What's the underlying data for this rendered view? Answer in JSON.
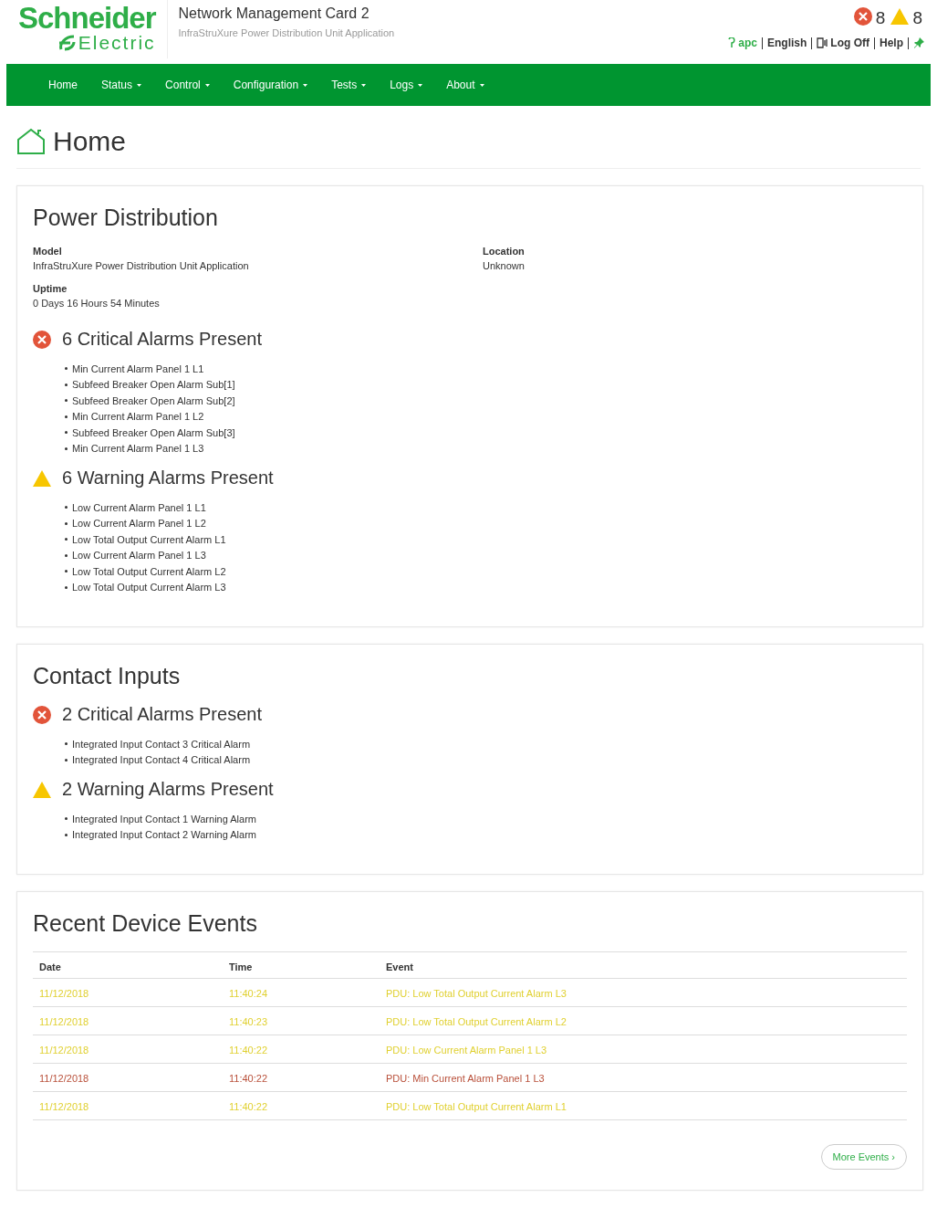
{
  "header": {
    "logo_top": "Schneider",
    "logo_bottom": "Electric",
    "title": "Network Management Card 2",
    "subtitle": "InfraStruXure Power Distribution Unit Application",
    "alarm_counts": [
      {
        "kind": "critical",
        "count": "8"
      },
      {
        "kind": "warning",
        "count": "8"
      }
    ],
    "user": "apc",
    "links": [
      "English",
      "Log Off",
      "Help"
    ]
  },
  "nav": [
    {
      "label": "Home",
      "dropdown": false
    },
    {
      "label": "Status",
      "dropdown": true
    },
    {
      "label": "Control",
      "dropdown": true
    },
    {
      "label": "Configuration",
      "dropdown": true
    },
    {
      "label": "Tests",
      "dropdown": true
    },
    {
      "label": "Logs",
      "dropdown": true
    },
    {
      "label": "About",
      "dropdown": true
    }
  ],
  "page_title": "Home",
  "power_distribution": {
    "title": "Power Distribution",
    "fields": [
      {
        "label": "Model",
        "value": "InfraStruXure Power Distribution Unit Application"
      },
      {
        "label": "Location",
        "value": "Unknown"
      },
      {
        "label": "Uptime",
        "value": "0 Days 16 Hours 54 Minutes"
      }
    ],
    "alarm_groups": [
      {
        "kind": "critical",
        "heading": "6 Critical Alarms Present",
        "items": [
          "Min Current Alarm Panel 1 L1",
          "Subfeed Breaker Open Alarm Sub[1]",
          "Subfeed Breaker Open Alarm Sub[2]",
          "Min Current Alarm Panel 1 L2",
          "Subfeed Breaker Open Alarm Sub[3]",
          "Min Current Alarm Panel 1 L3"
        ]
      },
      {
        "kind": "warning",
        "heading": "6 Warning Alarms Present",
        "items": [
          "Low Current Alarm Panel 1 L1",
          "Low Current Alarm Panel 1 L2",
          "Low Total Output Current Alarm L1",
          "Low Current Alarm Panel 1 L3",
          "Low Total Output Current Alarm L2",
          "Low Total Output Current Alarm L3"
        ]
      }
    ]
  },
  "contact_inputs": {
    "title": "Contact Inputs",
    "alarm_groups": [
      {
        "kind": "critical",
        "heading": "2 Critical Alarms Present",
        "items": [
          "Integrated Input Contact 3 Critical Alarm",
          "Integrated Input Contact 4 Critical Alarm"
        ]
      },
      {
        "kind": "warning",
        "heading": "2 Warning Alarms Present",
        "items": [
          "Integrated Input Contact 1 Warning Alarm",
          "Integrated Input Contact 2 Warning Alarm"
        ]
      }
    ]
  },
  "recent_events": {
    "title": "Recent Device Events",
    "columns": [
      "Date",
      "Time",
      "Event"
    ],
    "rows": [
      {
        "kind": "warning",
        "cells": [
          "11/12/2018",
          "11:40:24",
          "PDU: Low Total Output Current Alarm L3"
        ]
      },
      {
        "kind": "warning",
        "cells": [
          "11/12/2018",
          "11:40:23",
          "PDU: Low Total Output Current Alarm L2"
        ]
      },
      {
        "kind": "warning",
        "cells": [
          "11/12/2018",
          "11:40:22",
          "PDU: Low Current Alarm Panel 1 L3"
        ]
      },
      {
        "kind": "critical",
        "cells": [
          "11/12/2018",
          "11:40:22",
          "PDU: Min Current Alarm Panel 1 L3"
        ]
      },
      {
        "kind": "warning",
        "cells": [
          "11/12/2018",
          "11:40:22",
          "PDU: Low Total Output Current Alarm L1"
        ]
      }
    ],
    "more_button": "More Events ›"
  }
}
